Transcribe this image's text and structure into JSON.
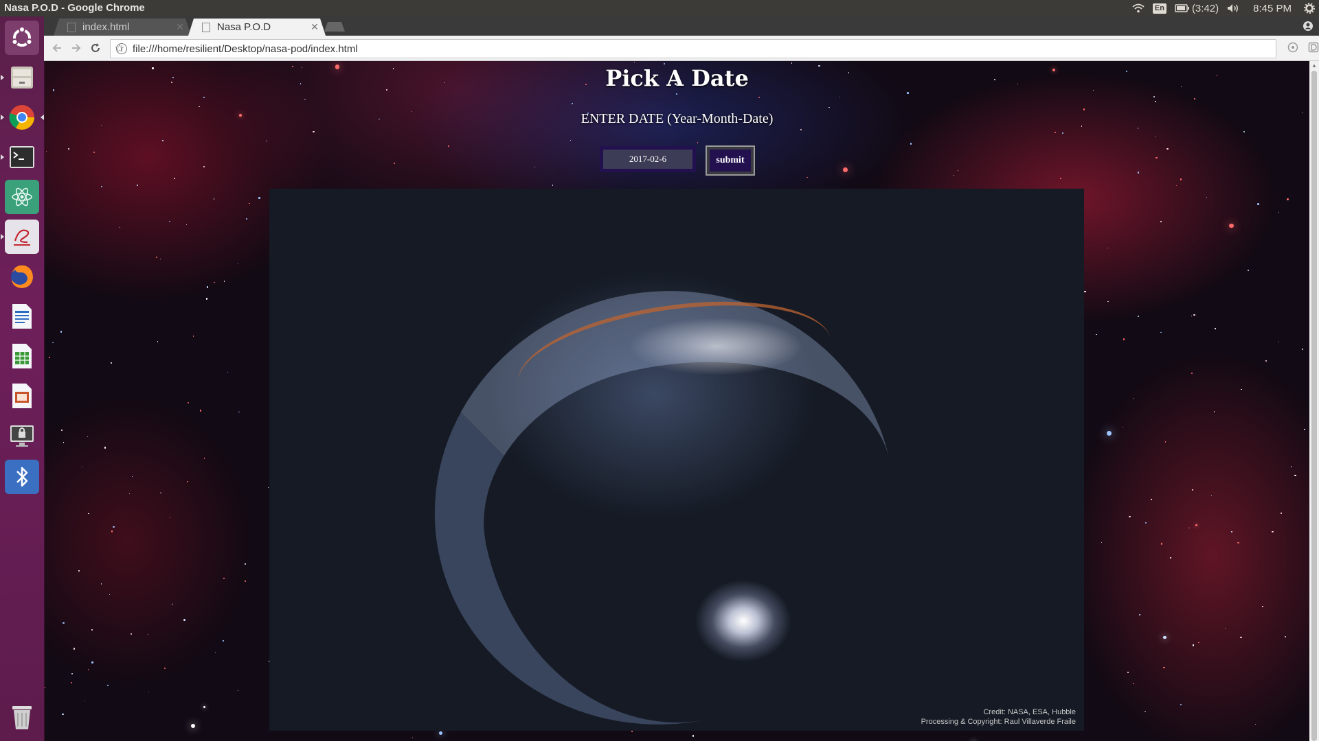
{
  "window": {
    "title": "Nasa P.O.D - Google Chrome"
  },
  "system_tray": {
    "language": "En",
    "battery": "(3:42)",
    "clock": "8:45 PM"
  },
  "tabs": [
    {
      "label": "index.html",
      "active": false
    },
    {
      "label": "Nasa P.O.D",
      "active": true
    }
  ],
  "address_bar": {
    "url": "file:///home/resilient/Desktop/nasa-pod/index.html"
  },
  "launcher": {
    "items": [
      "ubuntu-dash",
      "files",
      "chrome",
      "terminal",
      "atom",
      "text-editor",
      "firefox",
      "writer",
      "calc",
      "impress",
      "lock-screen",
      "bluetooth",
      "trash"
    ]
  },
  "page": {
    "title": "Pick A Date",
    "subtitle": "ENTER DATE (Year-Month-Date)",
    "date_input_value": "2017-02-6",
    "submit_label": "submit",
    "image_credit_line1": "Credit: NASA, ESA, Hubble",
    "image_credit_line2": "Processing & Copyright: Raul Villaverde Fraile"
  },
  "colors": {
    "button_bg": "#22114e",
    "launcher_bg": "#6e1f5a",
    "topbar_bg": "#3c3b37"
  }
}
